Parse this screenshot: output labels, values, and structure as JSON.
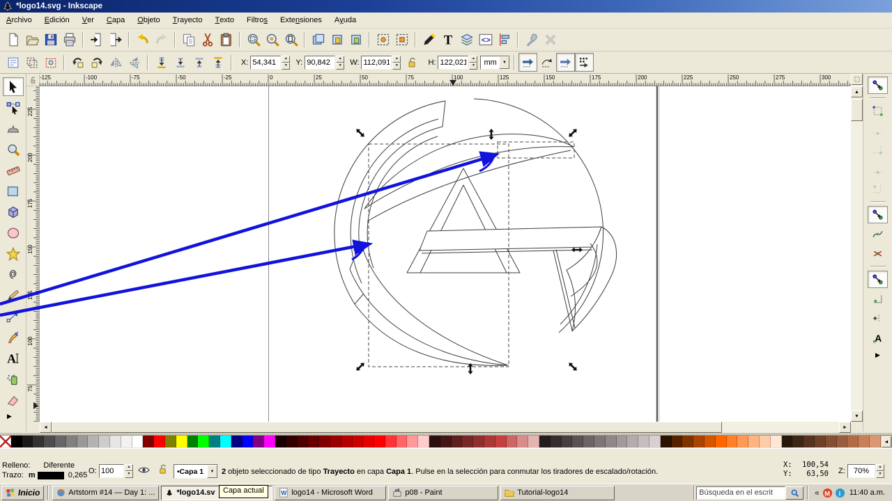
{
  "window": {
    "title": "*logo14.svg - Inkscape",
    "app_icon": "inkscape"
  },
  "menubar": {
    "items": [
      {
        "pre": "",
        "key": "A",
        "post": "rchivo"
      },
      {
        "pre": "",
        "key": "E",
        "post": "dición"
      },
      {
        "pre": "",
        "key": "V",
        "post": "er"
      },
      {
        "pre": "",
        "key": "C",
        "post": "apa"
      },
      {
        "pre": "",
        "key": "O",
        "post": "bjeto"
      },
      {
        "pre": "",
        "key": "T",
        "post": "rayecto"
      },
      {
        "pre": "",
        "key": "T",
        "post": "exto"
      },
      {
        "pre": "Filtro",
        "key": "s",
        "post": ""
      },
      {
        "pre": "Exte",
        "key": "n",
        "post": "siones"
      },
      {
        "pre": "A",
        "key": "y",
        "post": "uda"
      }
    ]
  },
  "toolbar_main": {
    "buttons": [
      {
        "icon": "new-document"
      },
      {
        "icon": "open-folder"
      },
      {
        "icon": "save"
      },
      {
        "icon": "print"
      },
      {
        "sep": true
      },
      {
        "icon": "import"
      },
      {
        "icon": "export"
      },
      {
        "sep": true
      },
      {
        "icon": "undo"
      },
      {
        "icon": "redo",
        "disabled": true
      },
      {
        "sep": true
      },
      {
        "icon": "copy"
      },
      {
        "icon": "cut"
      },
      {
        "icon": "paste"
      },
      {
        "sep": true
      },
      {
        "icon": "zoom-selection"
      },
      {
        "icon": "zoom-drawing"
      },
      {
        "icon": "zoom-page"
      },
      {
        "sep": true
      },
      {
        "icon": "duplicate"
      },
      {
        "icon": "clone"
      },
      {
        "icon": "unlink-clone"
      },
      {
        "sep": true
      },
      {
        "icon": "select-original"
      },
      {
        "icon": "paste-in-place"
      },
      {
        "sep": true
      },
      {
        "icon": "fill-stroke-dialog"
      },
      {
        "icon": "text-dialog"
      },
      {
        "icon": "layers-dialog"
      },
      {
        "icon": "xml-editor"
      },
      {
        "icon": "align-dialog"
      },
      {
        "sep": true
      },
      {
        "icon": "preferences"
      },
      {
        "icon": "input-devices",
        "disabled": true
      }
    ]
  },
  "toolbar_select": {
    "buttons": [
      {
        "icon": "select-all"
      },
      {
        "icon": "select-all-layers"
      },
      {
        "icon": "deselect"
      },
      {
        "sep": true
      },
      {
        "icon": "rotate-ccw"
      },
      {
        "icon": "rotate-cw"
      },
      {
        "icon": "flip-horizontal"
      },
      {
        "icon": "flip-vertical"
      },
      {
        "sep": true
      },
      {
        "icon": "lower-to-bottom"
      },
      {
        "icon": "lower"
      },
      {
        "icon": "raise"
      },
      {
        "icon": "raise-to-top"
      },
      {
        "sep": true
      }
    ],
    "fields": [
      {
        "id": "x",
        "label": "X:",
        "value": "54,341"
      },
      {
        "id": "y",
        "label": "Y:",
        "value": "90,842"
      },
      {
        "id": "w",
        "label": "W:",
        "value": "112,091"
      },
      {
        "id": "h",
        "label": "H:",
        "value": "122,021"
      }
    ],
    "lock_icon": "lock-open",
    "unit": {
      "value": "mm"
    },
    "toggles": [
      {
        "icon": "transform-stroke",
        "pressed": true
      },
      {
        "icon": "transform-corners",
        "pressed": false
      },
      {
        "icon": "transform-gradient",
        "pressed": true
      },
      {
        "icon": "transform-pattern",
        "pressed": true
      }
    ]
  },
  "rulers": {
    "top_labels": [
      "-125",
      "-100",
      "-75",
      "-50",
      "-25",
      "0",
      "25",
      "50",
      "75",
      "100",
      "125",
      "150",
      "175",
      "200",
      "225",
      "250",
      "275",
      "300"
    ],
    "left_labels": [
      "225",
      "200",
      "175",
      "150",
      "125",
      "100",
      "75"
    ]
  },
  "toolbox": {
    "tools": [
      {
        "icon": "selector",
        "active": true
      },
      {
        "icon": "node-editor"
      },
      {
        "icon": "tweak"
      },
      {
        "icon": "zoom"
      },
      {
        "icon": "measure"
      },
      {
        "icon": "rectangle"
      },
      {
        "icon": "box-3d"
      },
      {
        "icon": "ellipse"
      },
      {
        "icon": "star"
      },
      {
        "icon": "spiral"
      },
      {
        "icon": "pencil"
      },
      {
        "icon": "pen"
      },
      {
        "icon": "calligraphy"
      },
      {
        "icon": "text"
      },
      {
        "icon": "spray"
      },
      {
        "icon": "eraser"
      }
    ]
  },
  "snapbar": {
    "buttons": [
      {
        "icon": "snap-master",
        "pressed": true
      },
      {
        "sep": true
      },
      {
        "icon": "snap-bbox"
      },
      {
        "icon": "snap-bbox-edges",
        "disabled": true
      },
      {
        "icon": "snap-bbox-corners",
        "disabled": true
      },
      {
        "icon": "snap-bbox-edge-midpoints",
        "disabled": true
      },
      {
        "icon": "snap-bbox-centers",
        "disabled": true
      },
      {
        "sep": true
      },
      {
        "icon": "snap-nodes",
        "pressed": true
      },
      {
        "icon": "snap-paths"
      },
      {
        "icon": "snap-path-intersections"
      },
      {
        "sep": true
      },
      {
        "icon": "snap-others",
        "pressed": true
      },
      {
        "icon": "snap-object-centers"
      },
      {
        "icon": "snap-midpoints"
      },
      {
        "icon": "snap-text-baseline"
      }
    ]
  },
  "palette": {
    "colors": [
      "none",
      "#000000",
      "#1a1a1a",
      "#333333",
      "#4d4d4d",
      "#666666",
      "#808080",
      "#999999",
      "#b3b3b3",
      "#cccccc",
      "#e6e6e6",
      "#f2f2f2",
      "#ffffff",
      "#800000",
      "#ff0000",
      "#808000",
      "#ffff00",
      "#008000",
      "#00ff00",
      "#008080",
      "#00ffff",
      "#000080",
      "#0000ff",
      "#800080",
      "#ff00ff",
      "#1a0000",
      "#330000",
      "#4d0000",
      "#660000",
      "#800000",
      "#990000",
      "#b30000",
      "#cc0000",
      "#e60000",
      "#ff0000",
      "#ff3333",
      "#ff6666",
      "#ff9999",
      "#ffcccc",
      "#2b0f0f",
      "#451717",
      "#5e1f1f",
      "#782727",
      "#912f2f",
      "#ab3737",
      "#c44040",
      "#cc6666",
      "#d98c8c",
      "#e6b3b3",
      "#241c1c",
      "#362e2e",
      "#484040",
      "#5a5252",
      "#6c6464",
      "#7e7676",
      "#908888",
      "#a29a9a",
      "#b4acac",
      "#c6bebe",
      "#d8d0d0",
      "#2b1100",
      "#552200",
      "#803300",
      "#aa4400",
      "#d45500",
      "#ff6600",
      "#ff7f2a",
      "#ff9955",
      "#ffb380",
      "#ffccaa",
      "#ffe6d5",
      "#28170b",
      "#3f2515",
      "#56331f",
      "#6d4129",
      "#844f33",
      "#9b5d3d",
      "#b26b47",
      "#c97f59",
      "#d99873",
      "#e3b08f",
      "#edc8ab"
    ]
  },
  "statusbar": {
    "fill_label": "Relleno:",
    "fill_value": "Diferente",
    "stroke_label": "Trazo:",
    "stroke_prefix": "m",
    "stroke_value": "0,265",
    "opacity_label": "O:",
    "opacity_value": "100",
    "layer_label": "•Capa 1",
    "message": [
      {
        "text": "2",
        "bold": true
      },
      {
        "text": " objeto seleccionado de tipo "
      },
      {
        "text": "Trayecto",
        "bold": true
      },
      {
        "text": " en capa "
      },
      {
        "text": "Capa 1",
        "bold": true
      },
      {
        "text": ". Pulse en la selección para conmutar los tiradores de escalado/rotación."
      }
    ],
    "pos": {
      "x_label": "X:",
      "x": "100,54",
      "y_label": "Y:",
      "y": "63,50"
    },
    "zoom_label": "Z:",
    "zoom_value": "70%"
  },
  "tooltip": {
    "text": "Capa actual"
  },
  "taskbar": {
    "start_label": "Inicio",
    "tasks": [
      {
        "icon": "firefox",
        "label": "Artstorm #14 — Day 1: ..."
      },
      {
        "icon": "inkscape",
        "label": "*logo14.sv",
        "label_after": "pe",
        "active": true
      },
      {
        "icon": "word",
        "label": "logo14 - Microsoft Word"
      },
      {
        "icon": "paint",
        "label": "p08 - Paint"
      },
      {
        "icon": "folder",
        "label": "Tutorial-logo14"
      }
    ],
    "search": {
      "value": "Búsqueda en el escrit",
      "icon": "search"
    },
    "tray": {
      "chevron": "«",
      "icons": [
        "tray-m",
        "tray-i"
      ],
      "clock": "11:40 a.m."
    }
  }
}
